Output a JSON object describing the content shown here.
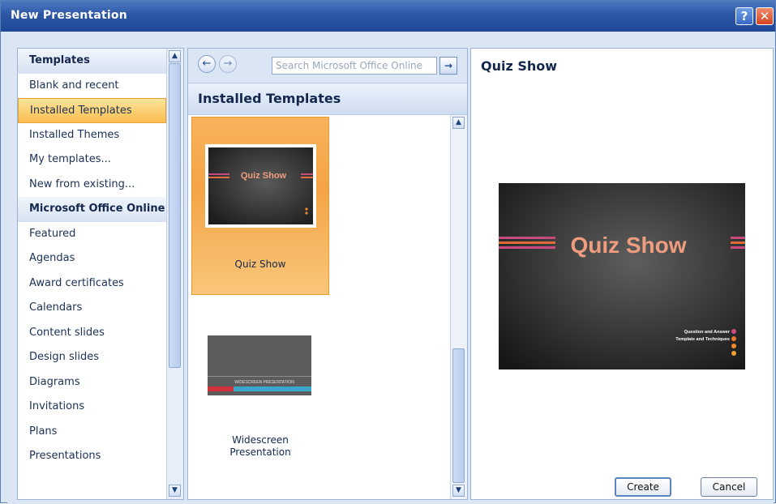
{
  "window": {
    "title": "New Presentation",
    "help_label": "?",
    "close_label": "✕"
  },
  "left": {
    "categories": [
      {
        "label": "Templates",
        "kind": "header"
      },
      {
        "label": "Blank and recent",
        "kind": "item"
      },
      {
        "label": "Installed Templates",
        "kind": "selected"
      },
      {
        "label": "Installed Themes",
        "kind": "item"
      },
      {
        "label": "My templates...",
        "kind": "item"
      },
      {
        "label": "New from existing...",
        "kind": "item"
      },
      {
        "label": "Microsoft Office Online",
        "kind": "header"
      },
      {
        "label": "Featured",
        "kind": "item"
      },
      {
        "label": "Agendas",
        "kind": "item"
      },
      {
        "label": "Award certificates",
        "kind": "item"
      },
      {
        "label": "Calendars",
        "kind": "item"
      },
      {
        "label": "Content slides",
        "kind": "item"
      },
      {
        "label": "Design slides",
        "kind": "item"
      },
      {
        "label": "Diagrams",
        "kind": "item"
      },
      {
        "label": "Invitations",
        "kind": "item"
      },
      {
        "label": "Plans",
        "kind": "item"
      },
      {
        "label": "Presentations",
        "kind": "item"
      }
    ]
  },
  "middle": {
    "search_placeholder": "Search Microsoft Office Online",
    "header": "Installed Templates",
    "templates": [
      {
        "label": "Quiz Show",
        "thumb_title": "Quiz Show",
        "selected": true
      },
      {
        "label": "Widescreen\nPresentation",
        "thumb_title": "WIDESCREEN PRESENTATION",
        "selected": false
      }
    ]
  },
  "preview": {
    "title": "Quiz Show",
    "slide_title": "Quiz Show",
    "slide_line1": "Question and Answer",
    "slide_line2": "Template and Techniques"
  },
  "buttons": {
    "create": "Create",
    "cancel": "Cancel"
  },
  "colors": {
    "title_bar": "#2d57a5",
    "selection": "#f9bd4e",
    "quiz_title": "#ef9d7e",
    "quiz_stripe": "#c94a7c"
  }
}
